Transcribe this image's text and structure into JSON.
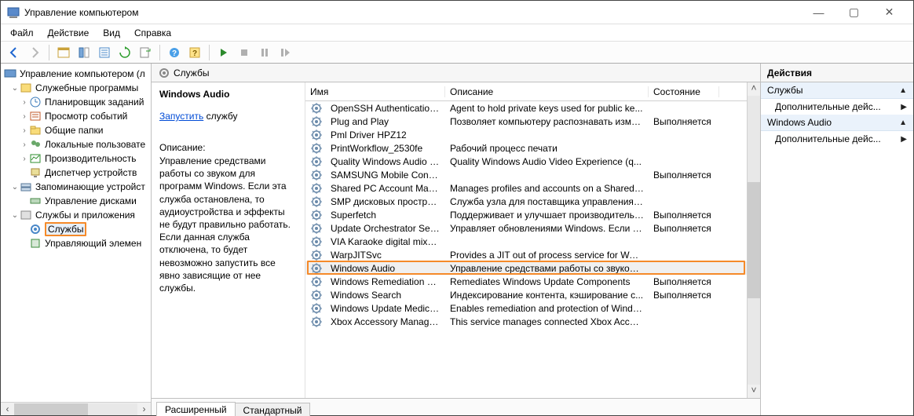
{
  "window_title": "Управление компьютером",
  "menu": [
    "Файл",
    "Действие",
    "Вид",
    "Справка"
  ],
  "tree": {
    "root": "Управление компьютером (л",
    "group1": "Служебные программы",
    "taskSched": "Планировщик заданий",
    "eventViewer": "Просмотр событий",
    "sharedFolders": "Общие папки",
    "localUsers": "Локальные пользовате",
    "perf": "Производительность",
    "devmgr": "Диспетчер устройств",
    "storage": "Запоминающие устройст",
    "diskmgr": "Управление дисками",
    "servicesApps": "Службы и приложения",
    "services": "Службы",
    "wmi": "Управляющий элемен"
  },
  "middle_header": "Службы",
  "detail": {
    "title": "Windows Audio",
    "action_link": "Запустить",
    "action_suffix": " службу",
    "desc_head": "Описание:",
    "desc_text": "Управление средствами работы со звуком для программ Windows.  Если эта служба остановлена, то аудиоустройства и эффекты не будут правильно работать.  Если данная служба отключена, то будет невозможно запустить все явно зависящие от нее службы."
  },
  "columns": {
    "name": "Имя",
    "desc": "Описание",
    "state": "Состояние"
  },
  "services": [
    {
      "name": "OpenSSH Authentication A...",
      "desc": "Agent to hold private keys used for public ke...",
      "state": ""
    },
    {
      "name": "Plug and Play",
      "desc": "Позволяет компьютеру распознавать изме...",
      "state": "Выполняется"
    },
    {
      "name": "Pml Driver HPZ12",
      "desc": "",
      "state": ""
    },
    {
      "name": "PrintWorkflow_2530fe",
      "desc": "Рабочий процесс печати",
      "state": ""
    },
    {
      "name": "Quality Windows Audio Vid...",
      "desc": "Quality Windows Audio Video Experience (q...",
      "state": ""
    },
    {
      "name": "SAMSUNG Mobile Connecti...",
      "desc": "",
      "state": "Выполняется"
    },
    {
      "name": "Shared PC Account Manager",
      "desc": "Manages profiles and accounts on a SharedP...",
      "state": ""
    },
    {
      "name": "SMP дисковых пространст...",
      "desc": "Служба узла для поставщика управления д...",
      "state": ""
    },
    {
      "name": "Superfetch",
      "desc": "Поддерживает и улучшает производительн...",
      "state": "Выполняется"
    },
    {
      "name": "Update Orchestrator Service",
      "desc": "Управляет обновлениями Windows. Если о...",
      "state": "Выполняется"
    },
    {
      "name": "VIA Karaoke digital mixer Se...",
      "desc": "",
      "state": ""
    },
    {
      "name": "WarpJITSvc",
      "desc": "Provides a JIT out of process service for WAR...",
      "state": ""
    },
    {
      "name": "Windows Audio",
      "desc": "Управление средствами работы со звуком ...",
      "state": "",
      "selected": true
    },
    {
      "name": "Windows Remediation Servi...",
      "desc": "Remediates Windows Update Components",
      "state": "Выполняется"
    },
    {
      "name": "Windows Search",
      "desc": "Индексирование контента, кэширование с...",
      "state": "Выполняется"
    },
    {
      "name": "Windows Update Medic Ser...",
      "desc": "Enables remediation and protection of Windo...",
      "state": ""
    },
    {
      "name": "Xbox Accessory Manageme...",
      "desc": "This service manages connected Xbox Access...",
      "state": ""
    }
  ],
  "tabs": {
    "extended": "Расширенный",
    "standard": "Стандартный"
  },
  "actions": {
    "title": "Действия",
    "group1": "Службы",
    "more1": "Дополнительные дейс...",
    "group2": "Windows Audio",
    "more2": "Дополнительные дейс..."
  }
}
